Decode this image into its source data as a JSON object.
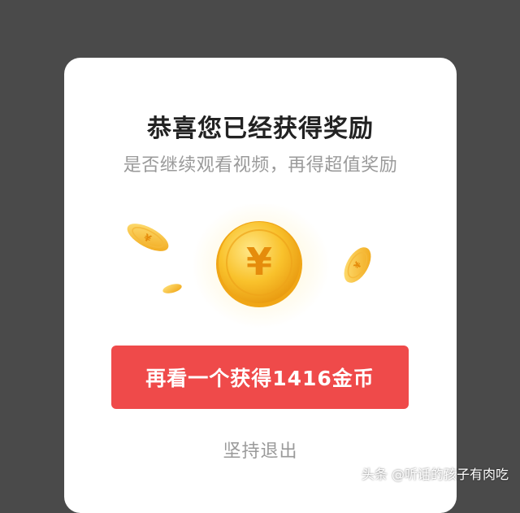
{
  "dialog": {
    "title": "恭喜您已经获得奖励",
    "subtitle": "是否继续观看视频，再得超值奖励",
    "primary_button": "再看一个获得1416金币",
    "exit_label": "坚持退出",
    "coin_icon": "yuan-coin-icon",
    "coin_symbol": "¥"
  },
  "watermark": "头条 @听话的孩子有肉吃",
  "colors": {
    "overlay": "#4a4a4a",
    "button": "#ef4a4a",
    "coin": "#f6b51b"
  }
}
